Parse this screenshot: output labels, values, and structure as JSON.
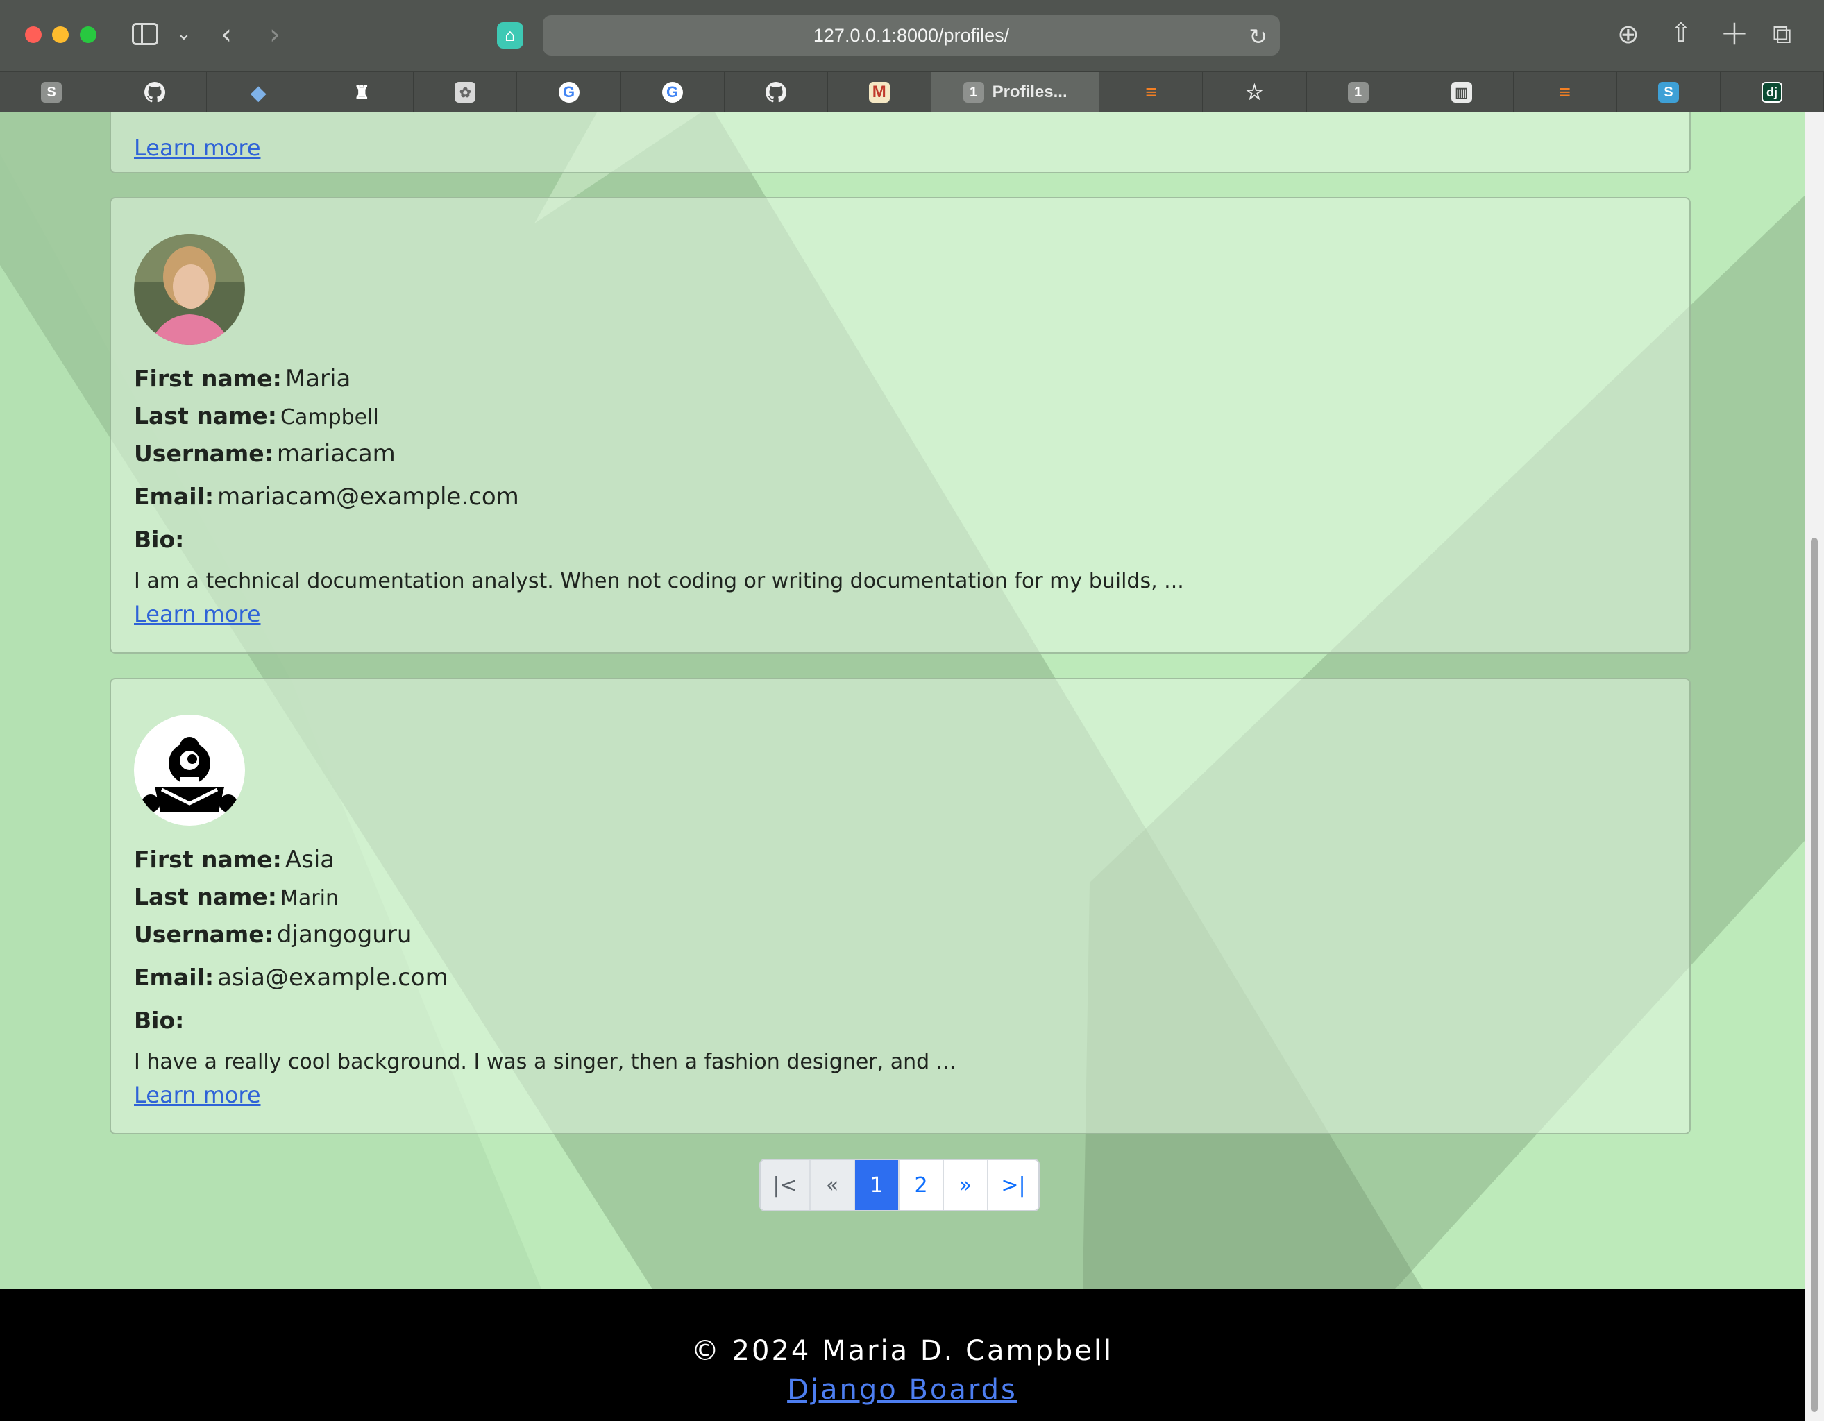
{
  "browser": {
    "url": "127.0.0.1:8000/profiles/",
    "tabs": [
      {
        "icon": "s-favicon",
        "glyph": "S"
      },
      {
        "icon": "github-icon",
        "glyph": "●"
      },
      {
        "icon": "python-icon",
        "glyph": "◆"
      },
      {
        "icon": "monster-icon",
        "glyph": "♜"
      },
      {
        "icon": "brain-icon",
        "glyph": "✿"
      },
      {
        "icon": "google-icon",
        "glyph": "G"
      },
      {
        "icon": "google-icon",
        "glyph": "G"
      },
      {
        "icon": "github-icon",
        "glyph": "●"
      },
      {
        "icon": "gmail-icon",
        "glyph": "M"
      },
      {
        "icon": "onepassword-icon",
        "glyph": "1",
        "label": "Profiles..."
      },
      {
        "icon": "stackoverflow-icon",
        "glyph": "≡"
      },
      {
        "icon": "star-icon",
        "glyph": "☆"
      },
      {
        "icon": "onepassword-icon",
        "glyph": "1"
      },
      {
        "icon": "columns-icon",
        "glyph": "▥"
      },
      {
        "icon": "stackoverflow-icon",
        "glyph": "≡"
      },
      {
        "icon": "s-favicon",
        "glyph": "S"
      },
      {
        "icon": "django-icon",
        "glyph": "dj"
      }
    ]
  },
  "profiles": {
    "partial": {
      "learn_more": "Learn more"
    },
    "maria": {
      "first_name_label": "First name:",
      "first_name": "Maria",
      "last_name_label": "Last name:",
      "last_name": "Campbell",
      "username_label": "Username:",
      "username": "mariacam",
      "email_label": "Email:",
      "email": "mariacam@example.com",
      "bio_label": "Bio:",
      "bio": "I am a technical documentation analyst. When not coding or writing documentation for my builds, ...",
      "learn_more": "Learn more"
    },
    "asia": {
      "first_name_label": "First name:",
      "first_name": "Asia",
      "last_name_label": "Last name:",
      "last_name": "Marin",
      "username_label": "Username:",
      "username": "djangoguru",
      "email_label": "Email:",
      "email": "asia@example.com",
      "bio_label": "Bio:",
      "bio": "I have a really cool background. I was a singer, then a fashion designer, and ...",
      "learn_more": "Learn more"
    }
  },
  "pagination": {
    "first": "|<",
    "prev": "«",
    "page1": "1",
    "page2": "2",
    "next": "»",
    "last": ">|",
    "active_page": 1
  },
  "footer": {
    "copyright": "© 2024 Maria D. Campbell",
    "link": "Django Boards"
  },
  "colors": {
    "page_background": "#bdeaba",
    "link": "#2f63d7",
    "active_page": "#2d6ef0"
  }
}
